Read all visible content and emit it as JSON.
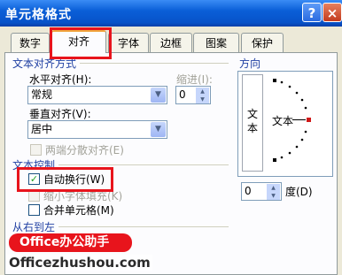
{
  "window": {
    "title": "单元格格式",
    "help": "?",
    "close": "×"
  },
  "tabs": [
    "数字",
    "对齐",
    "字体",
    "边框",
    "图案",
    "保护"
  ],
  "alignment": {
    "group": "文本对齐方式",
    "horizontal_label": "水平对齐(H):",
    "horizontal_value": "常规",
    "indent_label": "缩进(I):",
    "indent_value": "0",
    "vertical_label": "垂直对齐(V):",
    "vertical_value": "居中",
    "justify_distributed": "两端分散对齐(E)"
  },
  "text_control": {
    "group": "文本控制",
    "wrap_text": "自动换行(W)",
    "wrap_checked": true,
    "shrink_to_fit": "缩小字体填充(K)",
    "merge_cells": "合并单元格(M)"
  },
  "rtl": {
    "group": "从右到左"
  },
  "orientation": {
    "group": "方向",
    "vertical_text": "文本",
    "text": "文本",
    "degrees_value": "0",
    "degrees_label": "度(D)"
  },
  "watermark": {
    "banner": "Office办公助手",
    "site": "Officezhushou.com"
  },
  "colors": {
    "highlight": "#E8141C",
    "title_blue": "#0A5FD8"
  }
}
